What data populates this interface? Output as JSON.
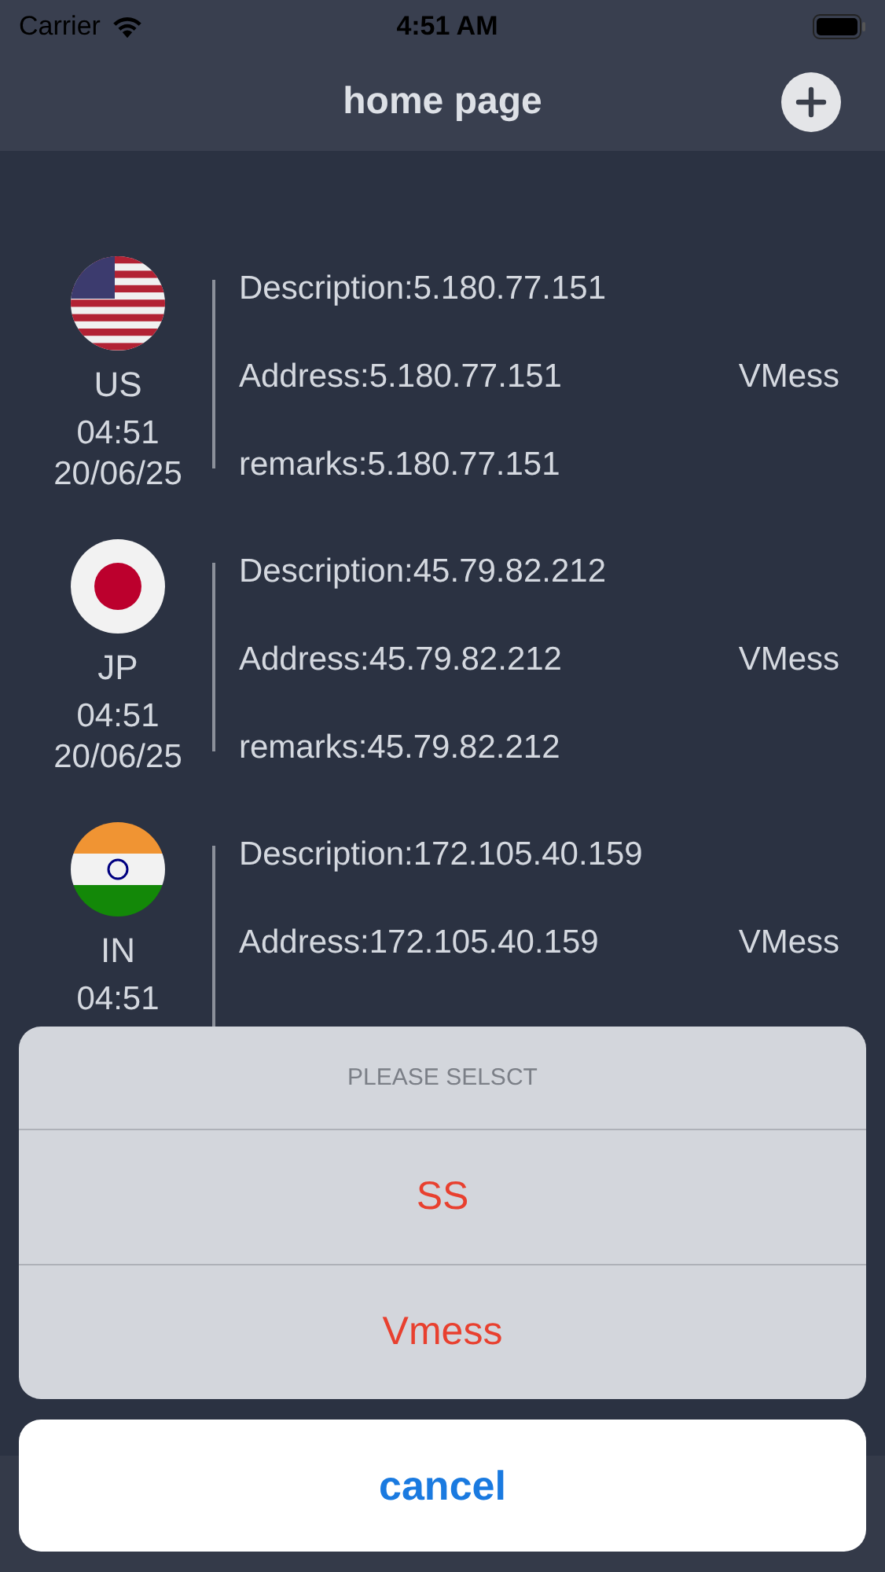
{
  "status_bar": {
    "carrier": "Carrier",
    "time": "4:51 AM"
  },
  "nav": {
    "title": "home page"
  },
  "servers": [
    {
      "kind": "us",
      "country": "US",
      "time": "04:51",
      "date": "20/06/25",
      "description": "Description:5.180.77.151",
      "address": "Address:5.180.77.151",
      "remarks": "remarks:5.180.77.151",
      "protocol": "VMess"
    },
    {
      "kind": "jp",
      "country": "JP",
      "time": "04:51",
      "date": "20/06/25",
      "description": "Description:45.79.82.212",
      "address": "Address:45.79.82.212",
      "remarks": "remarks:45.79.82.212",
      "protocol": "VMess"
    },
    {
      "kind": "in",
      "country": "IN",
      "time": "04:51",
      "description": "Description:172.105.40.159",
      "address": "Address:172.105.40.159",
      "protocol": "VMess"
    }
  ],
  "action_sheet": {
    "title": "PLEASE SELSCT",
    "options": [
      "SS",
      "Vmess"
    ],
    "cancel": "cancel"
  }
}
